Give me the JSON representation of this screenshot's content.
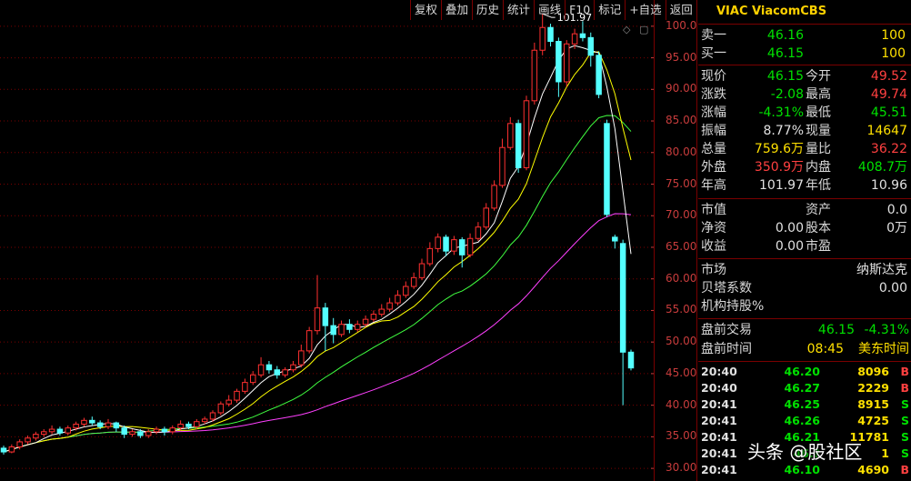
{
  "toolbar": {
    "buttons": [
      "复权",
      "叠加",
      "历史",
      "统计",
      "画线",
      "F10",
      "标记",
      "+自选",
      "返回"
    ]
  },
  "chart": {
    "high_marker": "101.97",
    "price_ticks": [
      "100.0",
      "95.00",
      "90.00",
      "85.00",
      "80.00",
      "75.00",
      "70.00",
      "65.00",
      "60.00",
      "55.00",
      "50.00",
      "45.00",
      "40.00",
      "35.00",
      "30.00"
    ],
    "colors": {
      "up": "#ff3030",
      "down": "#54ffff",
      "ma5": "#ffffff",
      "ma10": "#ffff00",
      "ma20": "#40ff40",
      "ma60": "#ff40ff",
      "grid": "#7a0000",
      "axis_text": "#c83c3c"
    }
  },
  "chart_data": {
    "type": "candlestick",
    "ylim": [
      28,
      103
    ],
    "candles": [
      [
        33.2,
        32.6,
        33.6,
        32.2
      ],
      [
        32.6,
        33.4,
        33.8,
        32.4
      ],
      [
        33.4,
        34.2,
        34.6,
        33.0
      ],
      [
        34.2,
        34.8,
        35.2,
        33.8
      ],
      [
        34.8,
        35.4,
        35.8,
        34.4
      ],
      [
        35.4,
        35.8,
        36.2,
        35.0
      ],
      [
        35.8,
        36.2,
        36.8,
        35.4
      ],
      [
        36.2,
        35.6,
        36.6,
        35.2
      ],
      [
        35.6,
        36.4,
        36.8,
        35.2
      ],
      [
        36.4,
        37.0,
        37.4,
        36.0
      ],
      [
        37.0,
        37.6,
        38.0,
        36.6
      ],
      [
        37.6,
        37.2,
        38.2,
        36.8
      ],
      [
        37.2,
        36.6,
        37.6,
        36.2
      ],
      [
        36.6,
        37.2,
        37.8,
        36.2
      ],
      [
        37.2,
        36.4,
        37.4,
        35.8
      ],
      [
        36.4,
        35.4,
        36.8,
        34.8
      ],
      [
        35.4,
        35.8,
        36.2,
        35.0
      ],
      [
        35.8,
        35.2,
        36.2,
        34.8
      ],
      [
        35.2,
        35.8,
        36.2,
        34.8
      ],
      [
        35.8,
        36.2,
        36.6,
        35.4
      ],
      [
        36.2,
        35.8,
        36.6,
        35.2
      ],
      [
        35.8,
        36.4,
        36.8,
        35.4
      ],
      [
        36.4,
        37.0,
        37.6,
        36.0
      ],
      [
        37.0,
        36.6,
        37.4,
        36.2
      ],
      [
        36.6,
        37.4,
        37.8,
        36.2
      ],
      [
        37.4,
        37.8,
        38.2,
        37.0
      ],
      [
        37.8,
        38.8,
        39.2,
        37.4
      ],
      [
        38.8,
        40.2,
        40.6,
        38.4
      ],
      [
        40.2,
        40.8,
        41.6,
        39.8
      ],
      [
        40.8,
        42.2,
        42.6,
        40.4
      ],
      [
        42.2,
        43.6,
        44.2,
        41.8
      ],
      [
        43.6,
        44.8,
        45.4,
        43.2
      ],
      [
        44.8,
        46.4,
        47.6,
        44.4
      ],
      [
        46.4,
        45.6,
        47.0,
        45.0
      ],
      [
        45.6,
        44.8,
        46.2,
        44.2
      ],
      [
        44.8,
        45.6,
        46.0,
        44.4
      ],
      [
        45.6,
        46.4,
        47.0,
        45.2
      ],
      [
        46.4,
        48.6,
        49.6,
        46.0
      ],
      [
        48.6,
        51.8,
        52.4,
        48.2
      ],
      [
        51.8,
        55.4,
        60.6,
        51.2
      ],
      [
        55.4,
        52.6,
        56.2,
        48.6
      ],
      [
        52.6,
        51.2,
        53.8,
        49.8
      ],
      [
        51.2,
        52.8,
        53.4,
        50.8
      ],
      [
        52.8,
        52.0,
        53.6,
        51.4
      ],
      [
        52.0,
        52.8,
        53.4,
        51.6
      ],
      [
        52.8,
        53.6,
        54.2,
        52.4
      ],
      [
        53.6,
        54.4,
        55.0,
        53.2
      ],
      [
        54.4,
        55.2,
        56.0,
        54.0
      ],
      [
        55.2,
        56.2,
        57.0,
        54.8
      ],
      [
        56.2,
        57.4,
        58.2,
        55.8
      ],
      [
        57.4,
        58.8,
        59.6,
        57.0
      ],
      [
        58.8,
        60.2,
        61.0,
        58.4
      ],
      [
        60.2,
        62.4,
        63.2,
        59.8
      ],
      [
        62.4,
        64.8,
        65.8,
        62.0
      ],
      [
        64.8,
        66.6,
        67.2,
        64.2
      ],
      [
        66.6,
        64.4,
        67.0,
        63.6
      ],
      [
        64.4,
        66.2,
        66.8,
        63.8
      ],
      [
        66.2,
        63.8,
        66.6,
        61.8
      ],
      [
        63.8,
        66.4,
        67.2,
        63.4
      ],
      [
        66.4,
        68.2,
        69.0,
        66.0
      ],
      [
        68.2,
        71.2,
        72.0,
        67.8
      ],
      [
        71.2,
        74.8,
        75.6,
        70.8
      ],
      [
        74.8,
        80.8,
        82.2,
        74.4
      ],
      [
        80.8,
        84.6,
        85.6,
        80.4
      ],
      [
        84.6,
        77.6,
        85.2,
        76.8
      ],
      [
        77.6,
        88.2,
        89.0,
        77.2
      ],
      [
        88.2,
        96.2,
        97.4,
        87.6
      ],
      [
        96.2,
        99.8,
        101.97,
        95.4
      ],
      [
        99.8,
        97.6,
        100.4,
        96.8
      ],
      [
        97.6,
        91.2,
        98.2,
        88.8
      ],
      [
        91.2,
        97.2,
        97.8,
        90.4
      ],
      [
        97.2,
        98.8,
        99.6,
        96.4
      ],
      [
        98.8,
        98.2,
        100.8,
        97.6
      ],
      [
        98.2,
        95.4,
        99.0,
        93.6
      ],
      [
        95.4,
        89.2,
        96.0,
        88.6
      ],
      [
        84.6,
        70.2,
        85.2,
        69.8
      ],
      [
        66.6,
        66.0,
        67.0,
        64.8
      ],
      [
        65.6,
        48.4,
        66.2,
        40.0
      ],
      [
        48.4,
        45.9,
        48.8,
        45.5
      ]
    ]
  },
  "quote_panel": {
    "title": "VIAC ViacomCBS",
    "ask1": {
      "label": "卖一",
      "price": "46.16",
      "vol": "100"
    },
    "bid1": {
      "label": "买一",
      "price": "46.15",
      "vol": "100"
    },
    "stats": [
      {
        "l1": "现价",
        "v1": "46.15",
        "c1": "green",
        "l2": "今开",
        "v2": "49.52",
        "c2": "red"
      },
      {
        "l1": "涨跌",
        "v1": "-2.08",
        "c1": "green",
        "l2": "最高",
        "v2": "49.74",
        "c2": "red"
      },
      {
        "l1": "涨幅",
        "v1": "-4.31%",
        "c1": "green",
        "l2": "最低",
        "v2": "45.51",
        "c2": "green"
      },
      {
        "l1": "振幅",
        "v1": "8.77%",
        "c1": "white",
        "l2": "现量",
        "v2": "14647",
        "c2": "yellow"
      },
      {
        "l1": "总量",
        "v1": "759.6万",
        "c1": "yellow",
        "l2": "量比",
        "v2": "36.22",
        "c2": "red"
      },
      {
        "l1": "外盘",
        "v1": "350.9万",
        "c1": "red",
        "l2": "内盘",
        "v2": "408.7万",
        "c2": "green"
      },
      {
        "l1": "年高",
        "v1": "101.97",
        "c1": "white",
        "l2": "年低",
        "v2": "10.96",
        "c2": "white"
      }
    ],
    "fundamentals": [
      {
        "l1": "市值",
        "v1": "",
        "l2": "资产",
        "v2": "0.0"
      },
      {
        "l1": "净资",
        "v1": "0.00",
        "l2": "股本",
        "v2": "0万"
      },
      {
        "l1": "收益",
        "v1": "0.00",
        "l2": "市盈",
        "v2": ""
      }
    ],
    "market": {
      "label": "市场",
      "value": "纳斯达克"
    },
    "beta": {
      "label": "贝塔系数",
      "value": "0.00"
    },
    "inst": {
      "label": "机构持股%",
      "value": ""
    },
    "premarket": {
      "label": "盘前交易",
      "price": "46.15",
      "pct": "-4.31%"
    },
    "pretime": {
      "label": "盘前时间",
      "time": "08:45",
      "tz": "美东时间"
    },
    "ticks": [
      {
        "time": "20:40",
        "price": "46.20",
        "vol": "8096",
        "side": "B"
      },
      {
        "time": "20:40",
        "price": "46.27",
        "vol": "2229",
        "side": "B"
      },
      {
        "time": "20:41",
        "price": "46.25",
        "vol": "8915",
        "side": "S"
      },
      {
        "time": "20:41",
        "price": "46.26",
        "vol": "4725",
        "side": "S"
      },
      {
        "time": "20:41",
        "price": "46.21",
        "vol": "11781",
        "side": "S"
      },
      {
        "time": "20:41",
        "price": "46.?",
        "vol": "1",
        "side": "S"
      },
      {
        "time": "20:41",
        "price": "46.10",
        "vol": "4690",
        "side": "B"
      }
    ]
  },
  "watermark": "头条 @股社区"
}
